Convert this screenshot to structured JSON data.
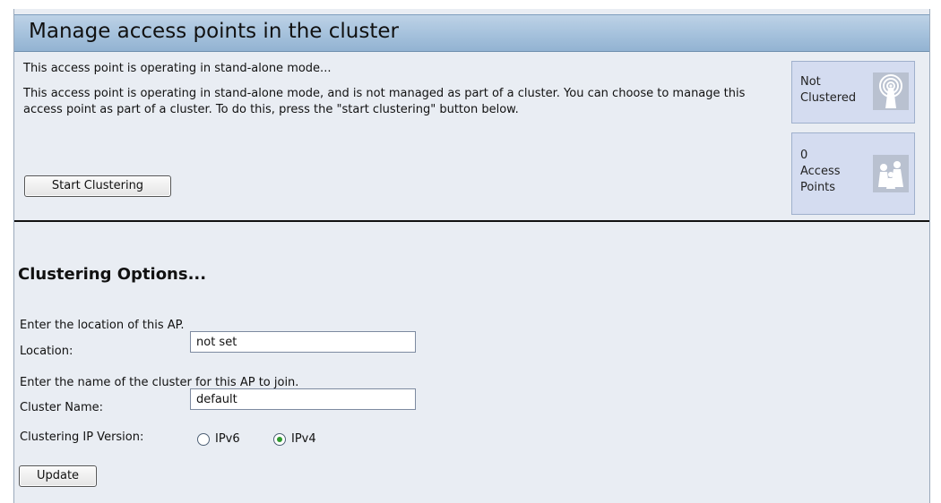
{
  "header": {
    "title": "Manage access points in the cluster"
  },
  "intro": {
    "status_line": "This access point is operating in stand-alone mode...",
    "description": "This access point is operating in stand-alone mode, and is not managed as part of a cluster. You can choose to manage this access point as part of a cluster. To do this, press the \"start clustering\" button below.",
    "start_button_label": "Start Clustering"
  },
  "status": {
    "cluster_line1": "Not",
    "cluster_line2": "Clustered",
    "cluster_icon": "wireless-tower-icon",
    "count": "0",
    "count_line1": "Access",
    "count_line2": "Points",
    "count_icon": "access-points-group-icon"
  },
  "options": {
    "section_title": "Clustering Options...",
    "location_hint": "Enter the location of this AP.",
    "location_label": "Location:",
    "location_value": "not set",
    "cluster_hint": "Enter the name of the cluster for this AP to join.",
    "cluster_label": "Cluster Name:",
    "cluster_value": "default",
    "ip_version_label": "Clustering IP Version:",
    "ipv6_label": "IPv6",
    "ipv4_label": "IPv4",
    "selected_ip_version": "IPv4",
    "update_button_label": "Update"
  },
  "colors": {
    "title_bar": "#a9c4de",
    "panel_bg": "#e9edf3",
    "status_box_bg": "#d4dcf0",
    "radio_selected": "#2f9a2f"
  }
}
